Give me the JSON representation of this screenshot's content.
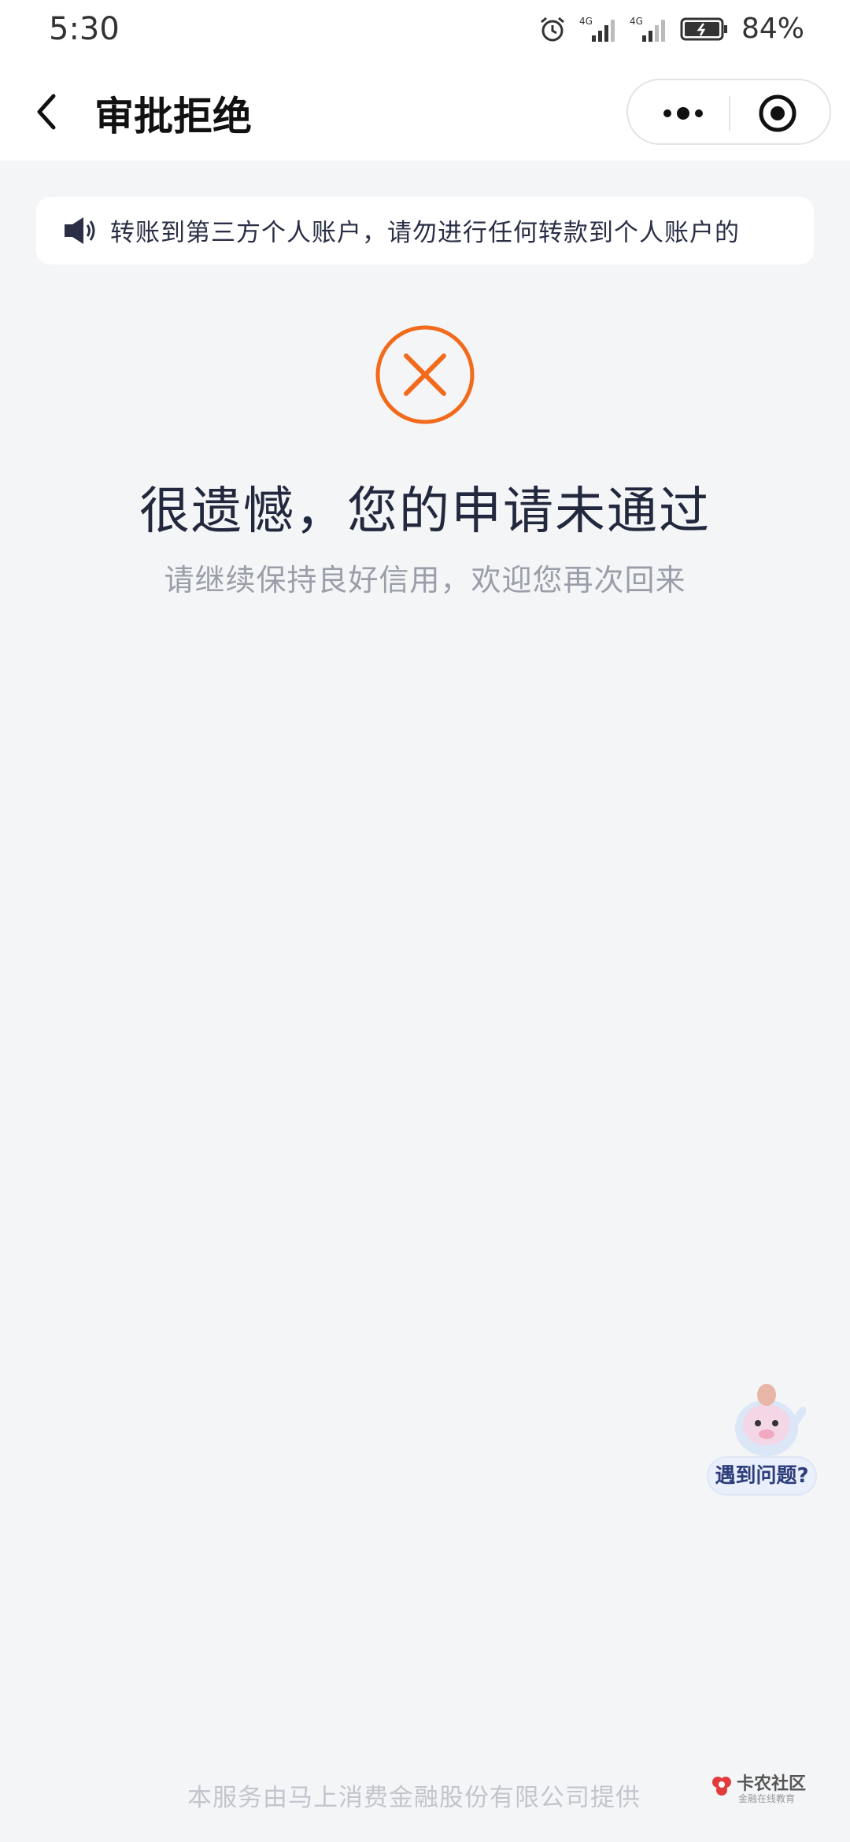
{
  "status_bar": {
    "time": "5:30",
    "signal1_label": "4G",
    "signal2_label": "4G",
    "battery": "84%"
  },
  "nav": {
    "title": "审批拒绝"
  },
  "notice": {
    "text": "转账到第三方个人账户，请勿进行任何转款到个人账户的"
  },
  "result": {
    "title": "很遗憾，您的申请未通过",
    "subtitle": "请继续保持良好信用，欢迎您再次回来"
  },
  "helper": {
    "label": "遇到问题?"
  },
  "footer": {
    "text": "本服务由马上消费金融股份有限公司提供"
  },
  "watermark": {
    "title": "卡农社区",
    "subtitle": "金融在线教育"
  },
  "colors": {
    "accent_orange": "#f26a1b",
    "background": "#f4f5f7",
    "title_text": "#22283d",
    "subtitle_text": "#9a9ea8"
  },
  "icons": [
    "back-arrow-icon",
    "more-dots-icon",
    "close-circle-icon",
    "speaker-icon",
    "error-x-icon",
    "alarm-icon",
    "signal-icon",
    "battery-icon"
  ]
}
